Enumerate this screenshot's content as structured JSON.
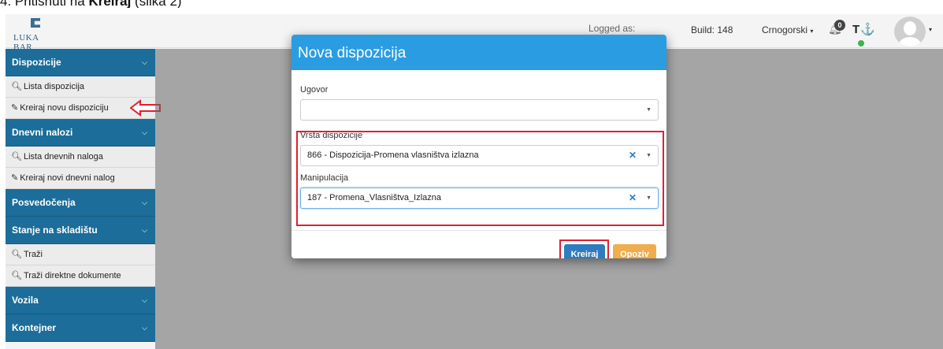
{
  "caption": {
    "prefix": "4. Pritisnuti na ",
    "bold": "Kreiraj",
    "suffix": " (slika 2)"
  },
  "navbar": {
    "logo_text": "LUKA BAR",
    "logged_as": "Logged as:",
    "build": "Build: 148",
    "language": "Crnogorski",
    "notifications_count": "0",
    "tools_icons": "T⚓"
  },
  "sidebar": {
    "sections": [
      {
        "label": "Dispozicije",
        "items": [
          "Lista dispozicija",
          "Kreiraj novu dispoziciju"
        ]
      },
      {
        "label": "Dnevni nalozi",
        "items": [
          "Lista dnevnih naloga",
          "Kreiraj novi dnevni nalog"
        ]
      },
      {
        "label": "Posvedočenja",
        "items": []
      },
      {
        "label": "Stanje na skladištu",
        "items": [
          "Traži",
          "Traži direktne dokumente"
        ]
      },
      {
        "label": "Vozila",
        "items": []
      },
      {
        "label": "Kontejner",
        "items": []
      }
    ]
  },
  "modal": {
    "title": "Nova dispozicija",
    "ugovor_label": "Ugovor",
    "ugovor_value": "",
    "vrsta_label": "Vrsta dispozicije",
    "vrsta_value": "866 - Dispozicija-Promena vlasništva izlazna",
    "manipulacija_label": "Manipulacija",
    "manipulacija_value": "187 - Promena_Vlasništva_Izlazna",
    "kreiraj_label": "Kreiraj",
    "opoziv_label": "Opoziv"
  },
  "colors": {
    "sidebar_header": "#1c6d99",
    "modal_header": "#2a9de2",
    "primary_button": "#2f7bbf",
    "warning_button": "#f0ad4e",
    "highlight_red": "#e02030"
  }
}
